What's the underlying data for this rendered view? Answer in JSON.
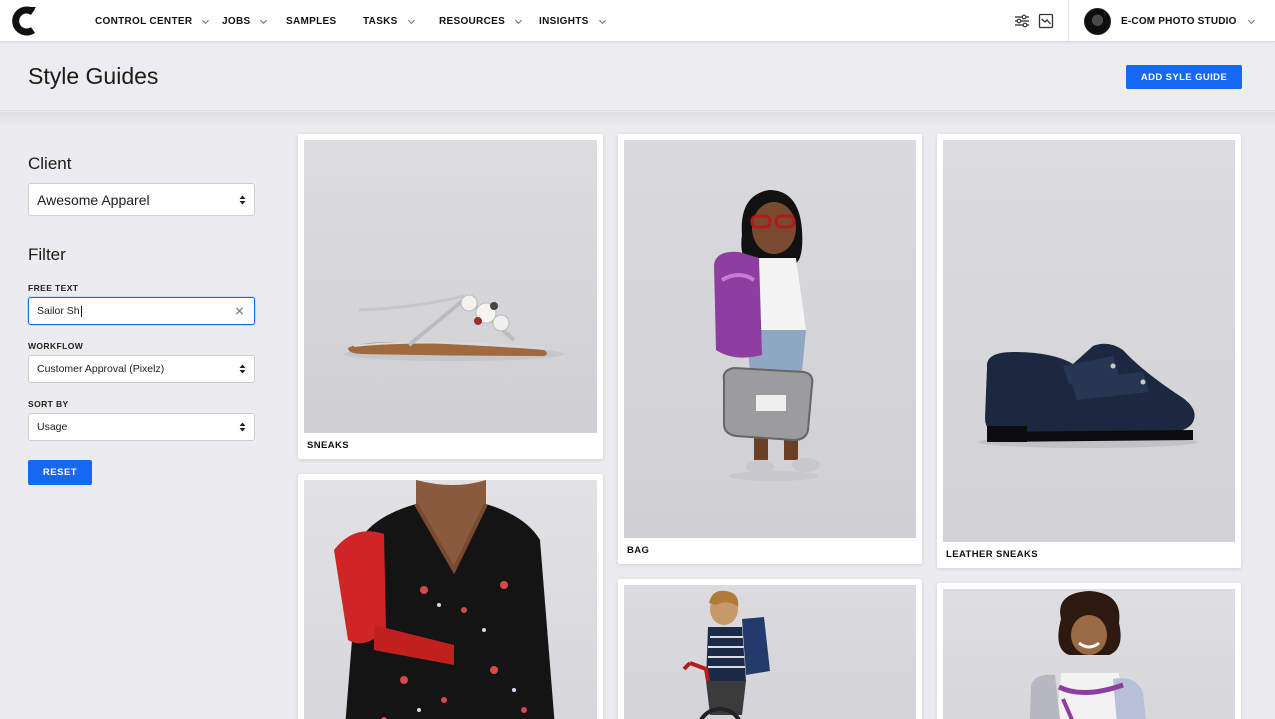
{
  "nav": {
    "items": [
      {
        "label": "CONTROL CENTER",
        "has_dropdown": true
      },
      {
        "label": "JOBS",
        "has_dropdown": true
      },
      {
        "label": "SAMPLES",
        "has_dropdown": false
      },
      {
        "label": "TASKS",
        "has_dropdown": true
      },
      {
        "label": "RESOURCES",
        "has_dropdown": true
      },
      {
        "label": "INSIGHTS",
        "has_dropdown": true
      }
    ],
    "icons": [
      "sliders-icon",
      "chart-icon"
    ],
    "studio_name": "E-COM PHOTO STUDIO"
  },
  "header": {
    "title": "Style Guides",
    "add_button": "ADD SYLE GUIDE"
  },
  "sidebar": {
    "client_title": "Client",
    "client_value": "Awesome Apparel",
    "filter_title": "Filter",
    "free_text_label": "FREE TEXT",
    "free_text_value": "Sailor Sh",
    "workflow_label": "WORKFLOW",
    "workflow_value": "Customer Approval (Pixelz)",
    "sort_label": "SORT BY",
    "sort_value": "Usage",
    "reset_button": "RESET"
  },
  "cards": [
    {
      "label": "SNEAKS"
    },
    {
      "label": "BAG"
    },
    {
      "label": "LEATHER SNEAKS"
    },
    {
      "label": ""
    },
    {
      "label": ""
    },
    {
      "label": ""
    }
  ],
  "colors": {
    "accent": "#1469f0",
    "background": "#ececee",
    "card": "#ffffff"
  }
}
